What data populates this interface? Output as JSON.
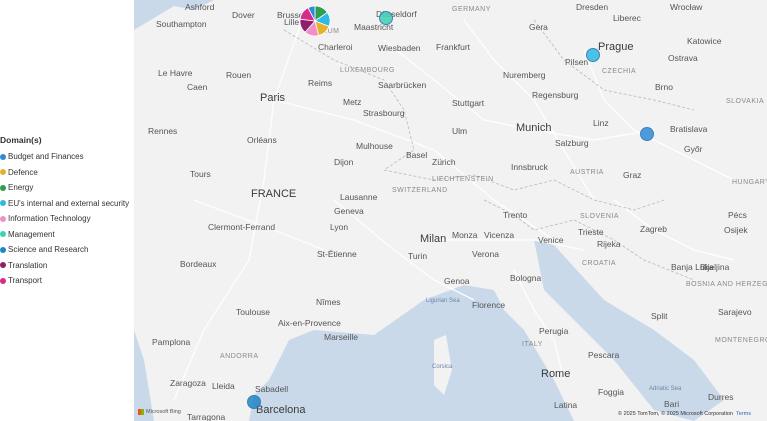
{
  "legend": {
    "title": "Domain(s)",
    "items": [
      {
        "label": "Budget and Finances",
        "color": "#2f8bd9"
      },
      {
        "label": "Defence",
        "color": "#e4b32b"
      },
      {
        "label": "Energy",
        "color": "#2e9e4f"
      },
      {
        "label": "EU's internal and external security",
        "color": "#2fb9e6"
      },
      {
        "label": "Information Technology",
        "color": "#f08fc8"
      },
      {
        "label": "Management",
        "color": "#3fd0b6"
      },
      {
        "label": "Science and Research",
        "color": "#1f86c4"
      },
      {
        "label": "Translation",
        "color": "#8f1f6b"
      },
      {
        "label": "Transport",
        "color": "#d62b8a"
      }
    ]
  },
  "map": {
    "labels": {
      "ashford": "Ashford",
      "dover": "Dover",
      "southampton": "Southampton",
      "brussels": "Brussels",
      "lille": "Lille",
      "charleroi": "Charleroi",
      "bium": "BIUM",
      "dusseldorf": "Düsseldorf",
      "maastricht": "Maastricht",
      "germany": "GERMANY",
      "dresden": "Dresden",
      "wroclaw": "Wrocław",
      "liberec": "Liberec",
      "gera": "Gera",
      "katowice": "Katowice",
      "wiesbaden": "Wiesbaden",
      "frankfurt": "Frankfurt",
      "prague": "Prague",
      "ostrava": "Ostrava",
      "le_havre": "Le Havre",
      "rouen": "Rouen",
      "caen": "Caen",
      "reims": "Reims",
      "luxembourg": "LUXEMBOURG",
      "saarbrucken": "Saarbrücken",
      "nuremberg": "Nuremberg",
      "pilsen": "Pilsen",
      "czechia": "CZECHIA",
      "brno": "Brno",
      "paris": "Paris",
      "metz": "Metz",
      "stuttgart": "Stuttgart",
      "regensburg": "Regensburg",
      "slovakia": "SLOVAKIA",
      "rennes": "Rennes",
      "strasbourg": "Strasbourg",
      "ulm": "Ulm",
      "munich": "Munich",
      "linz": "Linz",
      "bratislava": "Bratislava",
      "orleans": "Orléans",
      "mulhouse": "Mulhouse",
      "salzburg": "Salzburg",
      "gyor": "Győr",
      "tours": "Tours",
      "dijon": "Dijon",
      "basel": "Basel",
      "zurich": "Zürich",
      "innsbruck": "Innsbruck",
      "austria": "AUSTRIA",
      "liechtenstein": "LIECHTENSTEIN",
      "graz": "Graz",
      "hungary": "HUNGARY",
      "france": "FRANCE",
      "switzerland": "SWITZERLAND",
      "lausanne": "Lausanne",
      "geneva": "Geneva",
      "trento": "Trento",
      "slovenia": "SLOVENIA",
      "pecs": "Pécs",
      "clermont": "Clermont-Ferrand",
      "lyon": "Lyon",
      "milan": "Milan",
      "monza": "Monza",
      "vicenza": "Vicenza",
      "venice": "Venice",
      "trieste": "Trieste",
      "rijeka": "Rijeka",
      "zagreb": "Zagreb",
      "osijek": "Osijek",
      "st_etienne": "St-Étienne",
      "turin": "Turin",
      "verona": "Verona",
      "croatia": "CROATIA",
      "banja_luka": "Banja Luka",
      "bijeljina": "Bijeljina",
      "bordeaux": "Bordeaux",
      "genoa": "Genoa",
      "bologna": "Bologna",
      "bosnia": "BOSNIA AND HERZEGOVINA",
      "nimes": "Nîmes",
      "ligurian_sea": "Ligurian Sea",
      "florence": "Florence",
      "toulouse": "Toulouse",
      "split": "Split",
      "aix": "Aix-en-Provence",
      "marseille": "Marseille",
      "perugia": "Perugia",
      "sarajevo": "Sarajevo",
      "pamplona": "Pamplona",
      "italy": "ITALY",
      "montenegro": "MONTENEGRO",
      "pescara": "Pescara",
      "andorra": "ANDORRA",
      "corsica": "Corsica",
      "rome": "Rome",
      "zaragoza": "Zaragoza",
      "lleida": "Lleida",
      "sabadell": "Sabadell",
      "foggia": "Foggia",
      "adriatic_sea": "Adriatic Sea",
      "bari": "Bari",
      "durres": "Durres",
      "barcelona": "Barcelona",
      "tarragona": "Tarragona",
      "latina": "Latina"
    },
    "bubbles": [
      {
        "place": "Maastricht",
        "color": "#3fd0b6"
      },
      {
        "place": "Prague",
        "color": "#2fb9e6"
      },
      {
        "place": "Vienna",
        "color": "#2f8bd9"
      },
      {
        "place": "Barcelona",
        "color": "#1f86c4"
      }
    ],
    "pie": {
      "place": "Brussels",
      "slices": [
        {
          "domain": "Energy",
          "value": 1,
          "color": "#2e9e4f"
        },
        {
          "domain": "EU's internal and external security",
          "value": 1,
          "color": "#2fb9e6"
        },
        {
          "domain": "Defence",
          "value": 1,
          "color": "#e4b32b"
        },
        {
          "domain": "Information Technology",
          "value": 1,
          "color": "#f08fc8"
        },
        {
          "domain": "Translation",
          "value": 1,
          "color": "#8f1f6b"
        },
        {
          "domain": "Transport",
          "value": 1,
          "color": "#d62b8a"
        },
        {
          "domain": "Budget and Finances",
          "value": 0.5,
          "color": "#2f8bd9"
        }
      ]
    },
    "attribution": "© 2025 TomTom, © 2025 Microsoft Corporation",
    "terms": "Terms",
    "bing": "Microsoft Bing"
  }
}
